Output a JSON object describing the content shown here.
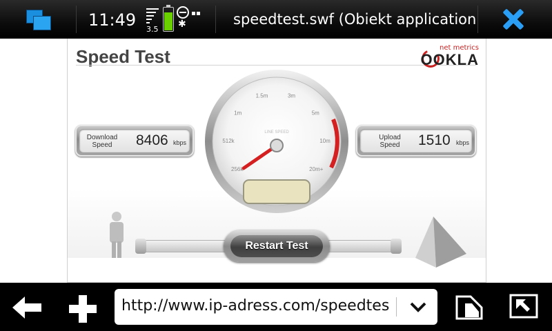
{
  "status_bar": {
    "time": "11:49",
    "network_type": "3.5",
    "window_title": "speedtest.swf (Obiekt application/x-shockwave-flash)",
    "icons": [
      "task-switcher-icon",
      "signal-icon",
      "battery-icon",
      "alarm-icon",
      "bluetooth-icon",
      "dots-icon",
      "close-icon"
    ],
    "accent_color": "#2a9df4",
    "battery_color": "#6ad000"
  },
  "speedtest": {
    "title": "Speed Test",
    "brand_tagline": "net metrics",
    "brand_name": "OOKLA",
    "download": {
      "label_line1": "Download",
      "label_line2": "Speed",
      "value": "8406",
      "unit": "kbps"
    },
    "upload": {
      "label_line1": "Upload",
      "label_line2": "Speed",
      "value": "1510",
      "unit": "kbps"
    },
    "gauge": {
      "ticks": [
        "256k",
        "512k",
        "1m",
        "1.5m",
        "3m",
        "5m",
        "10m",
        "20m+"
      ],
      "center_label": "LINE SPEED",
      "needle_position": "256k",
      "accent_color": "#d42020"
    },
    "restart_button": "Restart Test"
  },
  "toolbar": {
    "url": "http://www.ip-adress.com/speedtest",
    "icons": [
      "back-icon",
      "add-icon",
      "chevron-down-icon",
      "bookmark-icon",
      "fullscreen-icon"
    ]
  }
}
